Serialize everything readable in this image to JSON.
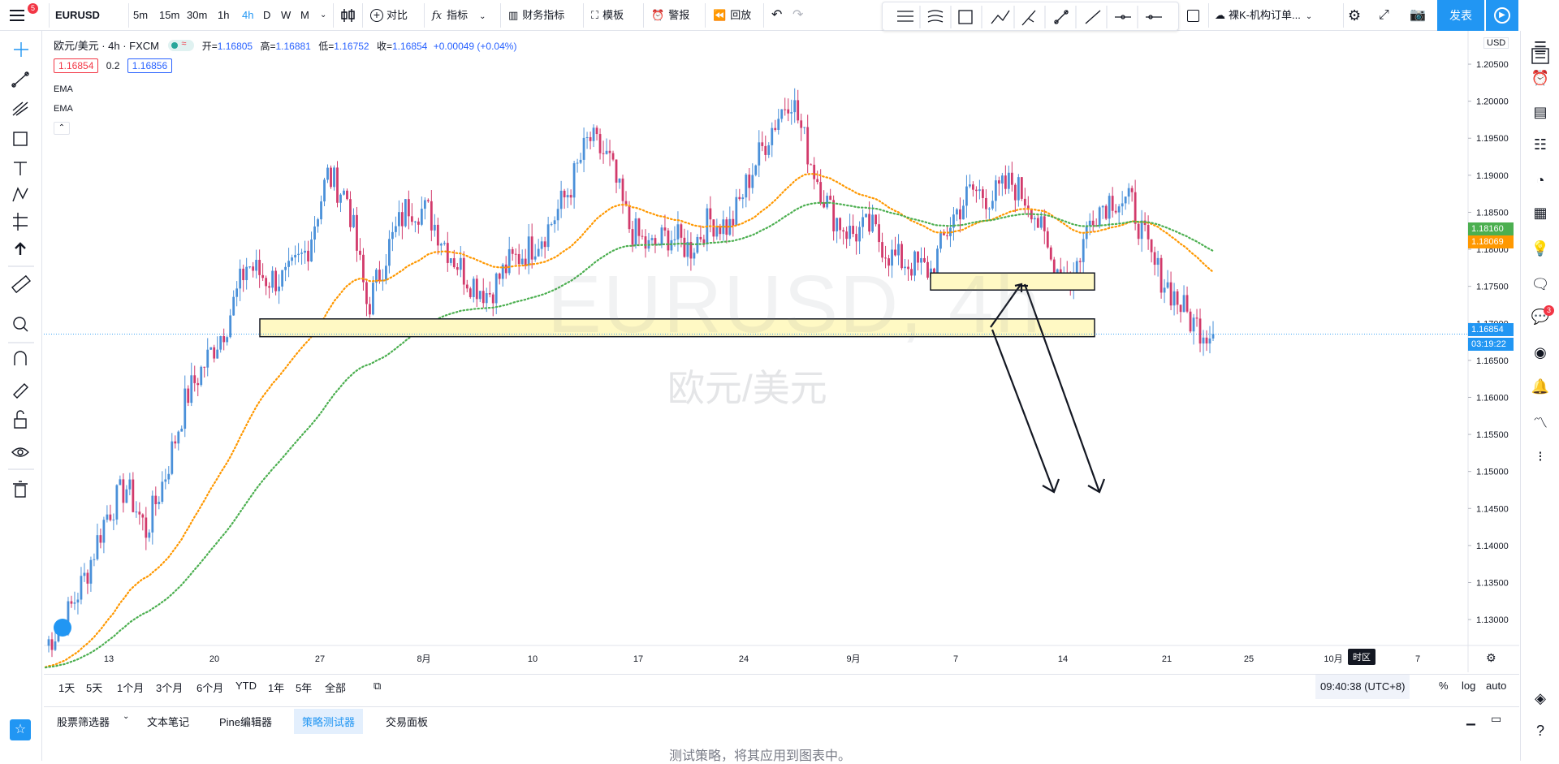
{
  "toolbar": {
    "menu_badge": "5",
    "symbol": "EURUSD",
    "intervals": [
      "5m",
      "15m",
      "30m",
      "1h",
      "4h",
      "D",
      "W",
      "M"
    ],
    "active_interval": "4h",
    "compare_label": "对比",
    "indicators_label": "指标",
    "financials_label": "财务指标",
    "templates_label": "模板",
    "alert_label": "警报",
    "replay_label": "回放",
    "layout_name": "裸K-机构订单...",
    "publish_label": "发表"
  },
  "legend": {
    "title": "欧元/美元 · 4h · FXCM",
    "open_label": "开=",
    "open": "1.16805",
    "high_label": "高=",
    "high": "1.16881",
    "low_label": "低=",
    "low": "1.16752",
    "close_label": "收=",
    "close": "1.16854",
    "change": "+0.00049 (+0.04%)",
    "bid": "1.16854",
    "spread": "0.2",
    "ask": "1.16856",
    "ema1": "EMA",
    "ema2": "EMA"
  },
  "watermark": {
    "symbol": "EURUSD, 4h",
    "name": "欧元/美元"
  },
  "axis": {
    "currency": "USD",
    "price_ticks": [
      "1.20500",
      "1.20000",
      "1.19500",
      "1.19000",
      "1.18500",
      "1.18000",
      "1.17500",
      "1.17000",
      "1.16500",
      "1.16000",
      "1.15500",
      "1.15000",
      "1.14500",
      "1.14000",
      "1.13500",
      "1.13000"
    ],
    "time_ticks": [
      "13",
      "20",
      "27",
      "8月",
      "10",
      "17",
      "24",
      "9月",
      "7",
      "14",
      "21",
      "25",
      "10月",
      "7"
    ],
    "ema_orange_label": "1.18069",
    "ema_green_label": "1.18160",
    "last_price_label": "1.16854",
    "countdown": "03:19:22",
    "timezone_tooltip": "时区"
  },
  "chart_data": {
    "type": "candlestick",
    "symbol": "EURUSD",
    "interval": "4h",
    "ylim": [
      1.1265,
      1.2095
    ],
    "x": [
      "13",
      "20",
      "27",
      "8月",
      "10",
      "17",
      "24",
      "9月",
      "7",
      "14",
      "21",
      "25",
      "10月",
      "7"
    ],
    "price_path": [
      1.1265,
      1.13,
      1.136,
      1.144,
      1.148,
      1.142,
      1.15,
      1.16,
      1.165,
      1.17,
      1.178,
      1.176,
      1.176,
      1.18,
      1.19,
      1.187,
      1.172,
      1.18,
      1.186,
      1.185,
      1.18,
      1.176,
      1.174,
      1.178,
      1.18,
      1.183,
      1.188,
      1.195,
      1.192,
      1.183,
      1.18,
      1.182,
      1.18,
      1.184,
      1.183,
      1.19,
      1.196,
      1.201,
      1.192,
      1.185,
      1.182,
      1.183,
      1.179,
      1.178,
      1.177,
      1.184,
      1.188,
      1.187,
      1.189,
      1.186,
      1.178,
      1.176,
      1.185,
      1.187,
      1.186,
      1.178,
      1.174,
      1.17,
      1.1685
    ],
    "series": [
      {
        "name": "EMA",
        "color": "#ff9800",
        "last": 1.18069
      },
      {
        "name": "EMA",
        "color": "#4caf50",
        "last": 1.1816
      }
    ],
    "zones": [
      {
        "from": 1.1682,
        "to": 1.1706
      },
      {
        "from": 1.1745,
        "to": 1.1768
      }
    ],
    "last_price": 1.16854,
    "grid": false
  },
  "bottom": {
    "ranges": [
      "1天",
      "5天",
      "1个月",
      "3个月",
      "6个月",
      "YTD",
      "1年",
      "5年",
      "全部"
    ],
    "clock": "09:40:38 (UTC+8)",
    "percent": "%",
    "log": "log",
    "auto": "auto",
    "tabs": [
      "股票筛选器",
      "文本笔记",
      "Pine编辑器",
      "策略测试器",
      "交易面板"
    ],
    "active_tab": "策略测试器",
    "panel_message": "测试策略，将其应用到图表中。"
  },
  "colors": {
    "up": "#4a90d9",
    "down": "#d23a6b",
    "accent": "#2196f3",
    "zone": "#fff9c4"
  }
}
